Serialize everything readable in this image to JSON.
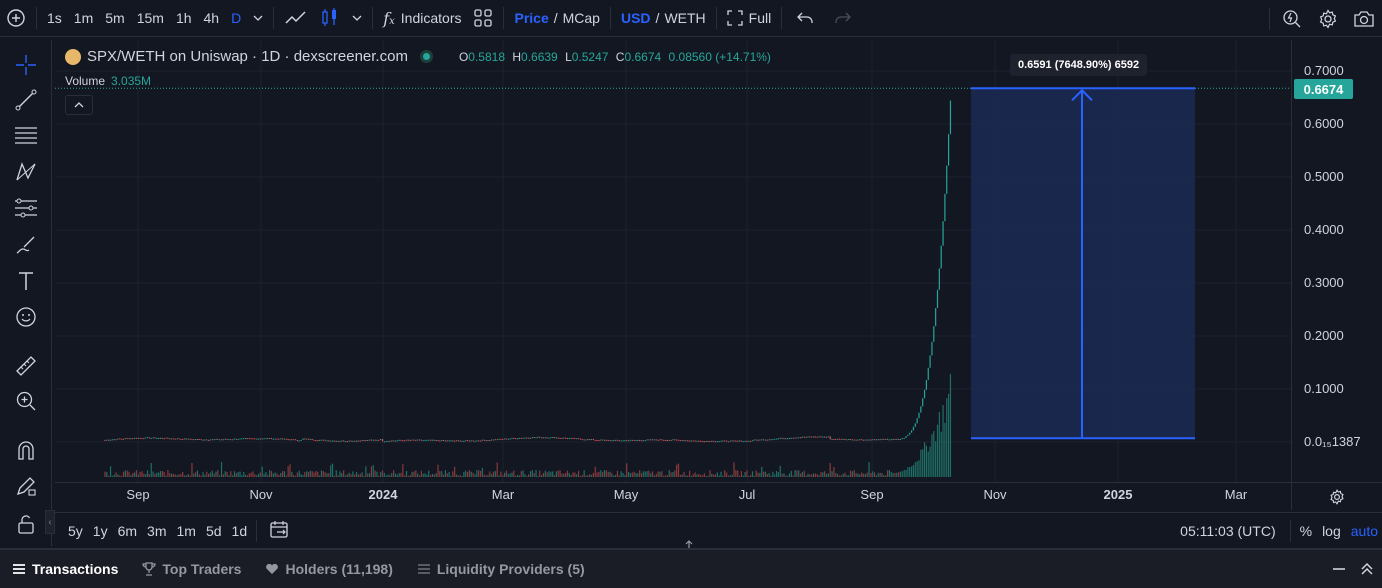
{
  "toolbar": {
    "intervals": [
      "1s",
      "1m",
      "5m",
      "15m",
      "1h",
      "4h",
      "D"
    ],
    "active_interval": "D",
    "indicators_label": "Indicators",
    "price_label": "Price",
    "mcap_label": "MCap",
    "usd_label": "USD",
    "weth_label": "WETH",
    "slash": "/",
    "full_label": "Full"
  },
  "legend": {
    "symbol": "SPX/WETH on Uniswap · 1D · dexscreener.com",
    "o_label": "O",
    "o_value": "0.5818",
    "h_label": "H",
    "h_value": "0.6639",
    "l_label": "L",
    "l_value": "0.5247",
    "c_label": "C",
    "c_value": "0.6674",
    "change": "0.08560 (+14.71%)",
    "volume_label": "Volume",
    "volume_value": "3.035M"
  },
  "measure_tooltip": "0.6591 (7648.90%) 6592",
  "price_scale": {
    "ticks": [
      "0.7000",
      "0.6000",
      "0.5000",
      "0.4000",
      "0.3000",
      "0.2000",
      "0.1000",
      "0.0₁₅1387"
    ],
    "current_price": "0.6674"
  },
  "time_axis": {
    "ticks": [
      {
        "label": "Sep",
        "bold": false
      },
      {
        "label": "Nov",
        "bold": false
      },
      {
        "label": "2024",
        "bold": true
      },
      {
        "label": "Mar",
        "bold": false
      },
      {
        "label": "May",
        "bold": false
      },
      {
        "label": "Jul",
        "bold": false
      },
      {
        "label": "Sep",
        "bold": false
      },
      {
        "label": "Nov",
        "bold": false
      },
      {
        "label": "2025",
        "bold": true
      },
      {
        "label": "Mar",
        "bold": false
      }
    ]
  },
  "range_bar": {
    "ranges": [
      "5y",
      "1y",
      "6m",
      "3m",
      "1m",
      "5d",
      "1d"
    ],
    "clock": "05:11:03 (UTC)",
    "percent_label": "%",
    "log_label": "log",
    "auto_label": "auto"
  },
  "tabs": [
    {
      "label": "Transactions",
      "icon": "list-icon",
      "active": true
    },
    {
      "label": "Top Traders",
      "icon": "trophy-icon",
      "active": false
    },
    {
      "label": "Holders (11,198)",
      "icon": "heart-icon",
      "active": false
    },
    {
      "label": "Liquidity Providers (5)",
      "icon": "stack-icon",
      "active": false
    }
  ],
  "colors": {
    "accent": "#2962ff",
    "up": "#26a69a",
    "down": "#ef5350",
    "background": "#131722",
    "measure_fill": "#1c2a55"
  },
  "chart_data": {
    "type": "candlestick",
    "pair": "SPX/WETH",
    "ylim": [
      0.0,
      0.7
    ],
    "grid": true,
    "measure": {
      "from": 0.0071,
      "to": 0.6674,
      "label": "0.6591 (7648.90%) 6592"
    },
    "series": [
      {
        "name": "Price",
        "approx_values_by_month": [
          {
            "x": "2023-08",
            "y": 0.008
          },
          {
            "x": "2023-10",
            "y": 0.012
          },
          {
            "x": "2024-01",
            "y": 0.01
          },
          {
            "x": "2024-03",
            "y": 0.009
          },
          {
            "x": "2024-05",
            "y": 0.01
          },
          {
            "x": "2024-07",
            "y": 0.015
          },
          {
            "x": "2024-08",
            "y": 0.012
          },
          {
            "x": "2024-09",
            "y": 0.03
          },
          {
            "x": "2024-10",
            "y": 0.25
          },
          {
            "x": "2024-10-late",
            "y": 0.6674
          }
        ]
      }
    ]
  }
}
